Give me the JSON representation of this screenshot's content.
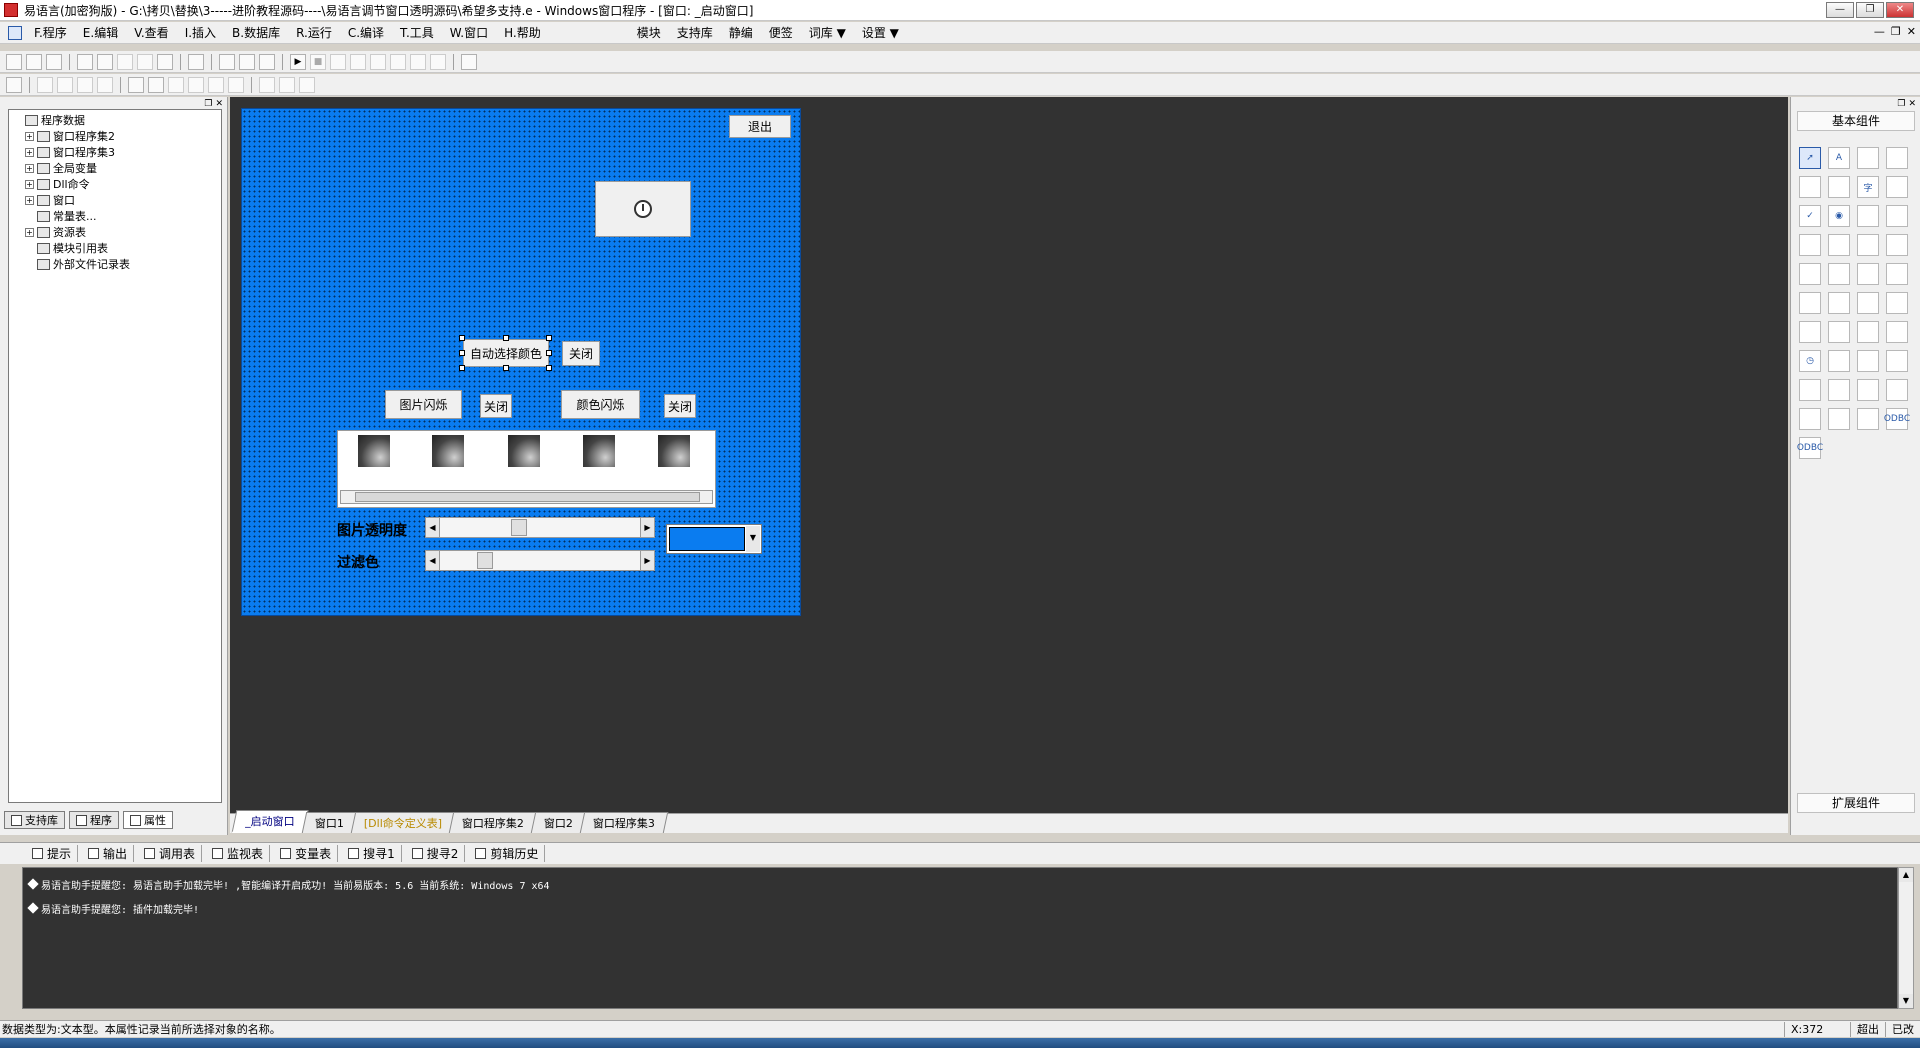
{
  "window": {
    "title": "易语言(加密狗版) - G:\\拷贝\\替换\\3-----进阶教程源码----\\易语言调节窗口透明源码\\希望多支持.e - Windows窗口程序 - [窗口: _启动窗口]",
    "buttons": [
      "—",
      "❐",
      "✕"
    ]
  },
  "menu": {
    "items": [
      "F.程序",
      "E.编辑",
      "V.查看",
      "I.插入",
      "B.数据库",
      "R.运行",
      "C.编译",
      "T.工具",
      "W.窗口",
      "H.帮助"
    ],
    "right_items": [
      "模块",
      "支持库",
      "静编",
      "便签",
      "词库 ▼",
      "设置 ▼"
    ],
    "mdi": [
      "—",
      "❐",
      "✕"
    ]
  },
  "left_panel": {
    "tree": [
      {
        "label": "程序数据",
        "level": 0,
        "expand": ""
      },
      {
        "label": "窗口程序集2",
        "level": 1,
        "expand": "+"
      },
      {
        "label": "窗口程序集3",
        "level": 1,
        "expand": "+"
      },
      {
        "label": "全局变量",
        "level": 1,
        "expand": "+"
      },
      {
        "label": "Dll命令",
        "level": 1,
        "expand": "+"
      },
      {
        "label": "窗口",
        "level": 1,
        "expand": "+"
      },
      {
        "label": "常量表...",
        "level": 1,
        "expand": ""
      },
      {
        "label": "资源表",
        "level": 1,
        "expand": "+"
      },
      {
        "label": "模块引用表",
        "level": 1,
        "expand": ""
      },
      {
        "label": "外部文件记录表",
        "level": 1,
        "expand": ""
      }
    ],
    "tabs": [
      "支持库",
      "程序",
      "属性"
    ]
  },
  "form": {
    "exit_button": "退出",
    "auto_color_button": "自动选择颜色",
    "close_button_1": "关闭",
    "image_flash_button": "图片闪烁",
    "close_button_2": "关闭",
    "color_flash_button": "颜色闪烁",
    "close_button_3": "关闭",
    "opacity_label": "图片透明度",
    "filter_label": "过滤色",
    "filter_color": "#0a7cf0",
    "form_color": "#0a7cf0",
    "opacity_slider_value": 0.38,
    "filter_slider_value": 0.2
  },
  "right_panel": {
    "header": "基本组件",
    "footer": "扩展组件"
  },
  "doc_tabs": [
    "_启动窗口",
    "窗口1",
    "[Dll命令定义表]",
    "窗口程序集2",
    "窗口2",
    "窗口程序集3"
  ],
  "output": {
    "tabs": [
      "提示",
      "输出",
      "调用表",
      "监视表",
      "变量表",
      "搜寻1",
      "搜寻2",
      "剪辑历史"
    ],
    "lines": [
      "易语言助手提醒您: 易语言助手加载完毕!  ,智能编译开启成功!  当前易版本: 5.6  当前系统: Windows 7 x64",
      "易语言助手提醒您: 插件加载完毕!"
    ]
  },
  "status": {
    "message": "数据类型为:文本型。本属性记录当前所选择对象的名称。",
    "coord": "X:372",
    "mode": "超出",
    "state": "已改"
  }
}
